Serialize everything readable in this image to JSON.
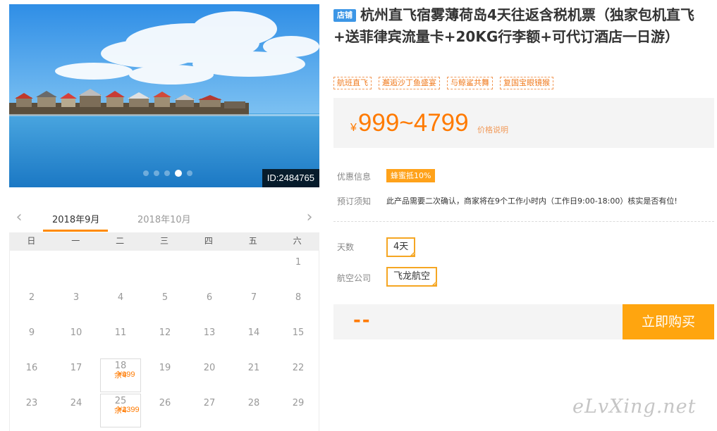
{
  "hero": {
    "id_label": "ID:2484765",
    "slide_count": 5,
    "active_slide": 4
  },
  "calendar": {
    "prev_icon": "chevron-left-icon",
    "next_icon": "chevron-right-icon",
    "months": [
      "2018年9月",
      "2018年10月"
    ],
    "active_month": 0,
    "weekdays": [
      "日",
      "一",
      "二",
      "三",
      "四",
      "五",
      "六"
    ],
    "first_weekday": 6,
    "days_shown": 29,
    "bookable": {
      "18": {
        "price": "¥999",
        "stock": "余4"
      },
      "25": {
        "price": "¥2399",
        "stock": "余4"
      }
    }
  },
  "product": {
    "shop_badge": "店铺",
    "title": "杭州直飞宿雾薄荷岛4天往返含税机票（独家包机直飞+送菲律宾流量卡+20KG行李额+可代订酒店一日游）",
    "tags": [
      "航班直飞",
      "邂逅沙丁鱼盛宴",
      "与鲸鲨共舞",
      "复国宝眼镜猴"
    ],
    "price_symbol": "¥",
    "price_range": "999~4799",
    "price_note": "价格说明",
    "discount_label": "优惠信息",
    "discount_badge": "蜂蜜抵10%",
    "notice_label": "预订须知",
    "notice_text": "此产品需要二次确认，商家将在9个工作小时内（工作日9:00-18:00）核实是否有位!",
    "days_label": "天数",
    "days_value": "4天",
    "airline_label": "航空公司",
    "airline_value": "飞龙航空",
    "total_placeholder": "--",
    "buy_label": "立即购买"
  },
  "watermark": "eLvXing.net",
  "colors": {
    "accent": "#ff7a00",
    "button": "#ffa50f",
    "badge": "#3c96e6"
  }
}
